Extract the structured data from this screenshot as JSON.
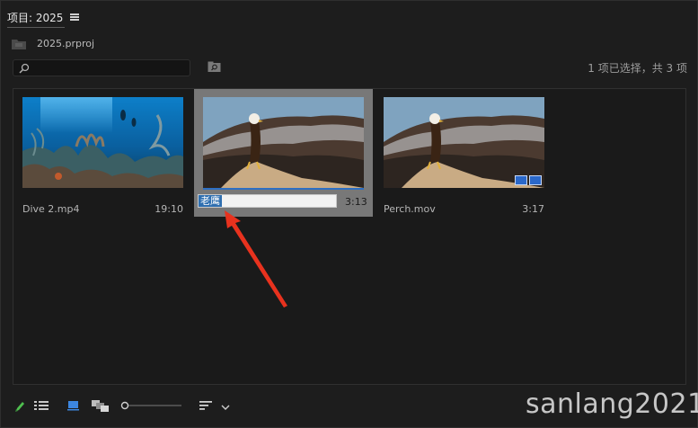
{
  "panel": {
    "title": "项目: 2025",
    "project_file": "2025.prproj"
  },
  "search": {
    "value": "",
    "placeholder": ""
  },
  "status": {
    "selection_text": "1 项已选择，共 3 项"
  },
  "clips": [
    {
      "name": "Dive 2.mp4",
      "duration": "19:10",
      "thumbnail": "underwater-coral-reef"
    },
    {
      "name": "老鹰",
      "duration": "3:13",
      "thumbnail": "bald-eagle-perch",
      "selected": true,
      "renaming": true
    },
    {
      "name": "Perch.mov",
      "duration": "3:17",
      "thumbnail": "bald-eagle-perch",
      "badges": [
        "video-track-icon",
        "audio-track-icon"
      ]
    }
  ],
  "toolbar": {
    "icons": [
      "pencil-icon",
      "list-view-icon",
      "icon-view-icon",
      "freeform-view-icon",
      "zoom-slider",
      "sort-icon",
      "chevron-down-icon"
    ]
  },
  "colors": {
    "accent": "#2e6fc2",
    "selection": "#2f6fb0",
    "annotation": "#e8321e"
  },
  "watermark": "sanlang2021"
}
